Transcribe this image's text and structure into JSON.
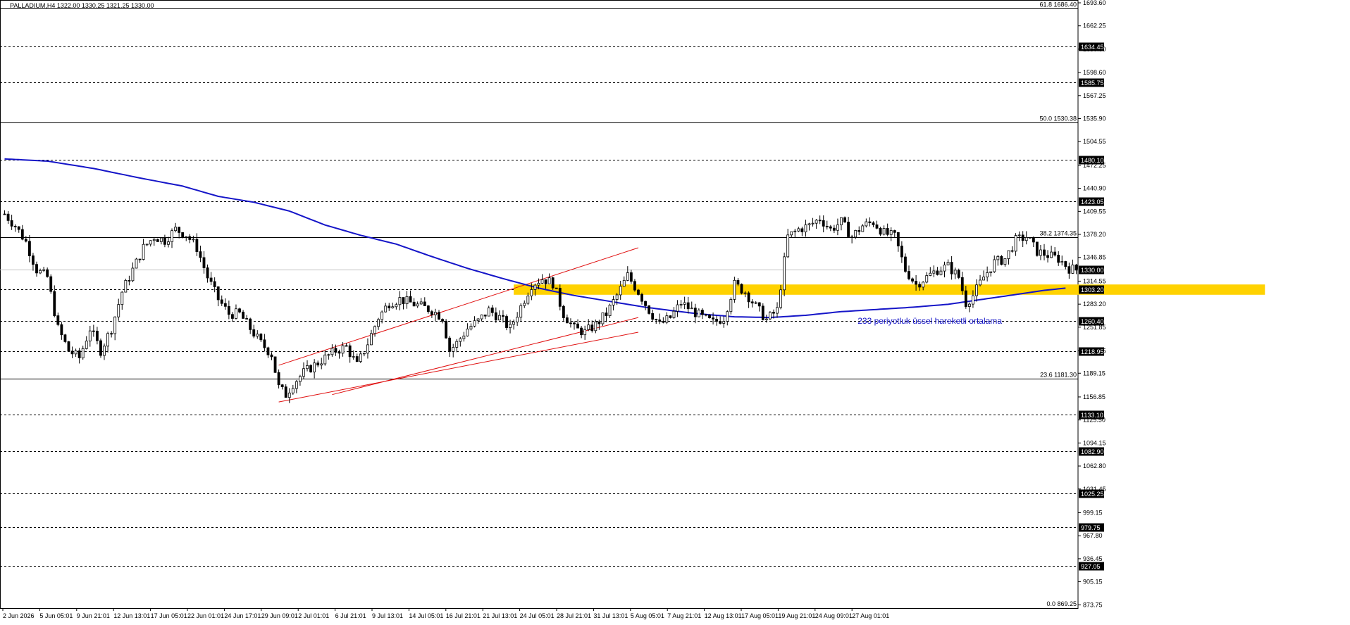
{
  "chart_data": {
    "type": "candlestick",
    "title": "PALLADIUM,H4  1322.00 1330.25 1321.25 1330.00",
    "ylim": [
      869.25,
      1693.6
    ],
    "y_ticks": [
      "1693.60",
      "1662.25",
      "1630.50",
      "1598.60",
      "1567.25",
      "1535.90",
      "1504.55",
      "1472.25",
      "1440.90",
      "1409.55",
      "1378.20",
      "1346.85",
      "1314.55",
      "1283.20",
      "1251.85",
      "1219.55",
      "1189.15",
      "1156.85",
      "1125.50",
      "1094.15",
      "1062.80",
      "1031.45",
      "999.15",
      "967.80",
      "936.45",
      "905.15",
      "873.75"
    ],
    "x_ticks": [
      "2 Jun 2026",
      "5 Jun 05:01",
      "9 Jun 21:01",
      "12 Jun 13:01",
      "17 Jun 05:01",
      "22 Jun 01:01",
      "24 Jun 17:01",
      "29 Jun 09:01",
      "2 Jul 01:01",
      "6 Jul 21:01",
      "9 Jul 13:01",
      "14 Jul 05:01",
      "16 Jul 21:01",
      "21 Jul 13:01",
      "24 Jul 05:01",
      "28 Jul 21:01",
      "31 Jul 13:01",
      "5 Aug 05:01",
      "7 Aug 21:01",
      "12 Aug 13:01",
      "17 Aug 05:01",
      "19 Aug 21:01",
      "24 Aug 09:01",
      "27 Aug 01:01"
    ],
    "current_price": "1330.00",
    "horizontal_levels": [
      "1634.45",
      "1585.75",
      "1480.10",
      "1423.05",
      "1303.20",
      "1260.40",
      "1218.95",
      "1133.10",
      "1082.90",
      "1025.25",
      "979.75",
      "927.05"
    ],
    "fibonacci_levels": [
      {
        "label": "61.8 1686.40",
        "value": 1686.4
      },
      {
        "label": "50.0 1530.38",
        "value": 1530.38
      },
      {
        "label": "38.2 1374.35",
        "value": 1374.35
      },
      {
        "label": "23.6 1181.30",
        "value": 1181.3
      },
      {
        "label": "0.0 869.25",
        "value": 869.25
      }
    ],
    "ema_label": "233 periyotluk üssel hareketli ortalama",
    "ema_path": [
      [
        0,
        1481
      ],
      [
        12,
        1478
      ],
      [
        25,
        1468
      ],
      [
        38,
        1455
      ],
      [
        50,
        1444
      ],
      [
        60,
        1430
      ],
      [
        70,
        1422
      ],
      [
        80,
        1410
      ],
      [
        90,
        1391
      ],
      [
        100,
        1377
      ],
      [
        110,
        1365
      ],
      [
        120,
        1348
      ],
      [
        130,
        1332
      ],
      [
        140,
        1318
      ],
      [
        150,
        1305
      ],
      [
        160,
        1295
      ],
      [
        170,
        1287
      ],
      [
        180,
        1279
      ],
      [
        188,
        1274
      ],
      [
        195,
        1270
      ],
      [
        205,
        1266
      ],
      [
        215,
        1265
      ],
      [
        225,
        1268
      ],
      [
        235,
        1273
      ],
      [
        245,
        1276
      ],
      [
        255,
        1279
      ],
      [
        265,
        1283
      ],
      [
        275,
        1290
      ],
      [
        285,
        1297
      ],
      [
        292,
        1302
      ],
      [
        298,
        1305
      ]
    ],
    "price_path": [
      [
        0,
        1406
      ],
      [
        3,
        1390
      ],
      [
        6,
        1368
      ],
      [
        9,
        1330
      ],
      [
        12,
        1320
      ],
      [
        15,
        1250
      ],
      [
        18,
        1220
      ],
      [
        21,
        1210
      ],
      [
        24,
        1250
      ],
      [
        27,
        1220
      ],
      [
        30,
        1250
      ],
      [
        33,
        1300
      ],
      [
        36,
        1330
      ],
      [
        39,
        1360
      ],
      [
        42,
        1375
      ],
      [
        45,
        1370
      ],
      [
        48,
        1385
      ],
      [
        51,
        1378
      ],
      [
        54,
        1360
      ],
      [
        57,
        1320
      ],
      [
        60,
        1290
      ],
      [
        63,
        1270
      ],
      [
        66,
        1270
      ],
      [
        69,
        1250
      ],
      [
        72,
        1230
      ],
      [
        75,
        1215
      ],
      [
        77,
        1170
      ],
      [
        79,
        1160
      ],
      [
        81,
        1175
      ],
      [
        84,
        1190
      ],
      [
        87,
        1200
      ],
      [
        90,
        1210
      ],
      [
        93,
        1220
      ],
      [
        96,
        1225
      ],
      [
        99,
        1200
      ],
      [
        102,
        1230
      ],
      [
        105,
        1265
      ],
      [
        108,
        1285
      ],
      [
        111,
        1290
      ],
      [
        114,
        1285
      ],
      [
        117,
        1280
      ],
      [
        120,
        1275
      ],
      [
        123,
        1265
      ],
      [
        125,
        1220
      ],
      [
        127,
        1230
      ],
      [
        130,
        1250
      ],
      [
        133,
        1260
      ],
      [
        136,
        1275
      ],
      [
        139,
        1265
      ],
      [
        142,
        1250
      ],
      [
        145,
        1280
      ],
      [
        148,
        1310
      ],
      [
        151,
        1318
      ],
      [
        154,
        1312
      ],
      [
        157,
        1270
      ],
      [
        160,
        1250
      ],
      [
        163,
        1245
      ],
      [
        166,
        1255
      ],
      [
        169,
        1270
      ],
      [
        172,
        1295
      ],
      [
        175,
        1322
      ],
      [
        178,
        1300
      ],
      [
        181,
        1275
      ],
      [
        184,
        1255
      ],
      [
        187,
        1265
      ],
      [
        190,
        1285
      ],
      [
        193,
        1275
      ],
      [
        196,
        1265
      ],
      [
        199,
        1258
      ],
      [
        202,
        1265
      ],
      [
        205,
        1310
      ],
      [
        208,
        1300
      ],
      [
        211,
        1280
      ],
      [
        214,
        1262
      ],
      [
        217,
        1275
      ],
      [
        220,
        1375
      ],
      [
        223,
        1385
      ],
      [
        226,
        1390
      ],
      [
        229,
        1400
      ],
      [
        232,
        1385
      ],
      [
        235,
        1395
      ],
      [
        238,
        1375
      ],
      [
        241,
        1390
      ],
      [
        244,
        1395
      ],
      [
        247,
        1380
      ],
      [
        250,
        1375
      ],
      [
        253,
        1330
      ],
      [
        256,
        1310
      ],
      [
        259,
        1320
      ],
      [
        262,
        1330
      ],
      [
        265,
        1335
      ],
      [
        268,
        1320
      ],
      [
        270,
        1285
      ],
      [
        272,
        1295
      ],
      [
        275,
        1320
      ],
      [
        278,
        1340
      ],
      [
        281,
        1345
      ],
      [
        284,
        1370
      ],
      [
        287,
        1375
      ],
      [
        290,
        1355
      ],
      [
        293,
        1350
      ],
      [
        296,
        1345
      ],
      [
        299,
        1332
      ],
      [
        301,
        1330
      ]
    ],
    "channel_lines": [
      [
        [
          77,
          1200
        ],
        [
          178,
          1360
        ]
      ],
      [
        [
          77,
          1150
        ],
        [
          178,
          1245
        ]
      ],
      [
        [
          92,
          1160
        ],
        [
          178,
          1265
        ]
      ]
    ],
    "support_zone": [
      143,
      1296,
      354,
      1310
    ],
    "candle_count": 302
  }
}
